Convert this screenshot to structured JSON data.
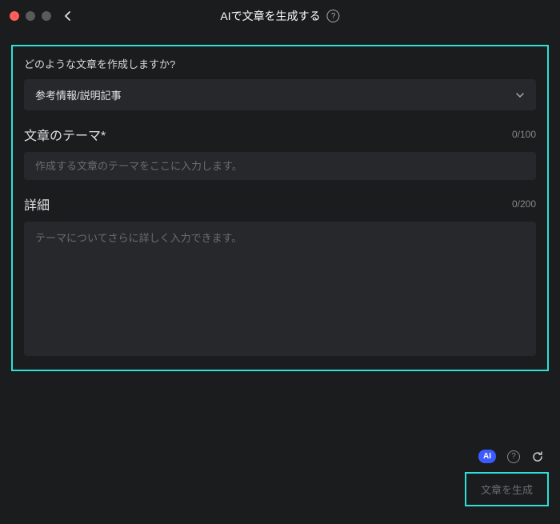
{
  "header": {
    "title": "AIで文章を生成する"
  },
  "form": {
    "typeLabel": "どのような文章を作成しますか?",
    "typeValue": "参考情報/説明記事",
    "themeLabel": "文章のテーマ*",
    "themeCounter": "0/100",
    "themePlaceholder": "作成する文章のテーマをここに入力します。",
    "detailLabel": "詳細",
    "detailCounter": "0/200",
    "detailPlaceholder": "テーマについてさらに詳しく入力できます。"
  },
  "footer": {
    "aiBadge": "AI",
    "generateLabel": "文章を生成"
  }
}
